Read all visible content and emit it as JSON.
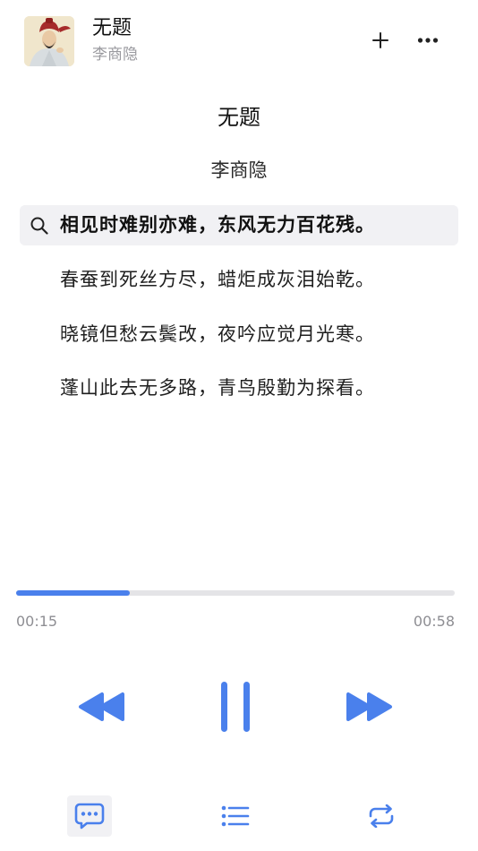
{
  "header": {
    "title": "无题",
    "subtitle": "李商隐",
    "avatar_icon": "poet-portrait-icon",
    "actions": [
      "plus-icon",
      "more-icon"
    ]
  },
  "poem": {
    "title": "无题",
    "author": "李商隐",
    "lines": [
      "相见时难别亦难，东风无力百花残。",
      "春蚕到死丝方尽，蜡炬成灰泪始乾。",
      "晓镜但愁云鬓改，夜吟应觉月光寒。",
      "蓬山此去无多路，青鸟殷勤为探看。"
    ],
    "active_line_index": 0
  },
  "player": {
    "elapsed": "00:15",
    "total": "00:58",
    "progress": 0.26,
    "state": "playing"
  },
  "bottom_bar": {
    "tabs": [
      "lyrics-icon",
      "playlist-icon",
      "repeat-icon"
    ],
    "active": "lyrics-icon"
  },
  "colors": {
    "accent": "#4a80ec",
    "track": "#e4e4e7",
    "highlight_bg": "#f1f1f4",
    "muted_text": "#8e8e93"
  }
}
